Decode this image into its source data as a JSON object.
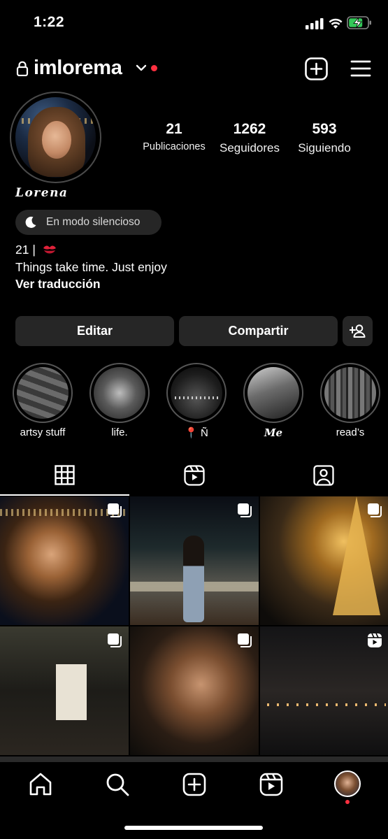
{
  "status_bar": {
    "time": "1:22"
  },
  "header": {
    "username": "imlorema"
  },
  "profile": {
    "display_name": "Lorena",
    "stats": [
      {
        "value": "21",
        "label": "Publicaciones"
      },
      {
        "value": "1262",
        "label": "Seguidores"
      },
      {
        "value": "593",
        "label": "Siguiendo"
      }
    ],
    "silent_mode": "En modo silencioso",
    "bio": {
      "line1": "21 |",
      "line2": "Things take time. Just enjoy",
      "translate": "Ver traducción"
    }
  },
  "actions": {
    "edit": "Editar",
    "share": "Compartir"
  },
  "highlights": [
    {
      "label": "artsy stuff"
    },
    {
      "label": "life."
    },
    {
      "label": "📍 Ñ"
    },
    {
      "label": "Me"
    },
    {
      "label": "read’s"
    }
  ],
  "tabs": [
    {
      "name": "grid-icon"
    },
    {
      "name": "reels-icon"
    },
    {
      "name": "tagged-icon"
    }
  ],
  "posts": [
    {
      "type": "carousel"
    },
    {
      "type": "carousel"
    },
    {
      "type": "carousel"
    },
    {
      "type": "carousel"
    },
    {
      "type": "carousel"
    },
    {
      "type": "reel"
    }
  ],
  "bottom_nav": [
    "home-icon",
    "search-icon",
    "create-icon",
    "reels-icon",
    "profile-avatar"
  ],
  "colors": {
    "background": "#000000",
    "button": "#262626",
    "notification": "#ff3040"
  }
}
